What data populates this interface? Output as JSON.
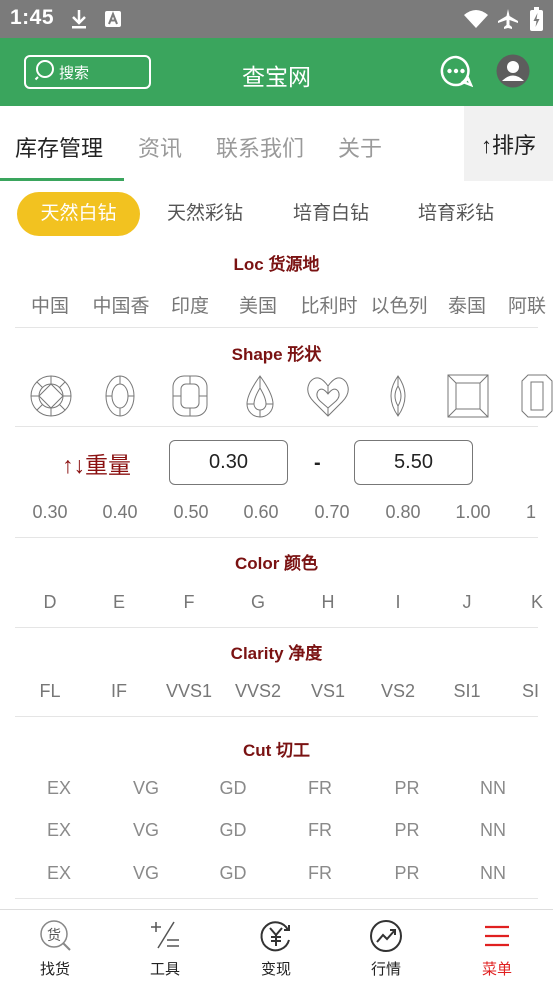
{
  "status": {
    "time": "1:45"
  },
  "header": {
    "search_label": "搜索",
    "title": "查宝网"
  },
  "main_tabs": [
    "库存管理",
    "资讯",
    "联系我们",
    "关于"
  ],
  "sort_label": "↑排序",
  "categories": [
    "天然白钻",
    "天然彩钻",
    "培育白钻",
    "培育彩钻"
  ],
  "loc": {
    "title": "Loc 货源地",
    "items": [
      "中国",
      "中国香",
      "印度",
      "美国",
      "比利时",
      "以色列",
      "泰国",
      "阿联"
    ]
  },
  "shape": {
    "title": "Shape 形状"
  },
  "weight": {
    "label": "↑↓重量",
    "min": "0.30",
    "max": "5.50",
    "dash": "-",
    "presets": [
      "0.30",
      "0.40",
      "0.50",
      "0.60",
      "0.70",
      "0.80",
      "1.00",
      "1"
    ]
  },
  "color": {
    "title": "Color 颜色",
    "items": [
      "D",
      "E",
      "F",
      "G",
      "H",
      "I",
      "J",
      "K"
    ]
  },
  "clarity": {
    "title": "Clarity 净度",
    "items": [
      "FL",
      "IF",
      "VVS1",
      "VVS2",
      "VS1",
      "VS2",
      "SI1",
      "SI"
    ]
  },
  "cut": {
    "title": "Cut 切工",
    "rows": [
      [
        "EX",
        "VG",
        "GD",
        "FR",
        "PR",
        "NN"
      ],
      [
        "EX",
        "VG",
        "GD",
        "FR",
        "PR",
        "NN"
      ],
      [
        "EX",
        "VG",
        "GD",
        "FR",
        "PR",
        "NN"
      ]
    ]
  },
  "bottom_nav": [
    "找货",
    "工具",
    "变现",
    "行情",
    "菜单"
  ],
  "colors": {
    "brand_green": "#3aa55d",
    "accent_yellow": "#f2c220",
    "section_red": "#7a1212",
    "nav_active": "#e02020"
  }
}
